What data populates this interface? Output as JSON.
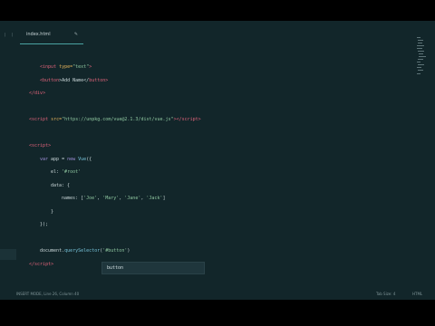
{
  "tab": {
    "filename": "index.html",
    "close_glyph": "✎"
  },
  "sidebar": {
    "toggle_glyph": "⟨ ⟩"
  },
  "code_lines": {
    "l1": {
      "open": "<",
      "tag": "input",
      "attr": " type=",
      "str": "\"text\"",
      "close": ">"
    },
    "l2": {
      "open": "<",
      "tag": "button",
      "mid": ">Add Name</",
      "tag2": "button",
      "close": ">"
    },
    "l3": {
      "open": "</",
      "tag": "div",
      "close": ">"
    },
    "l4": {
      "open": "<",
      "tag": "script",
      "attr": " src=",
      "str": "\"https://unpkg.com/vue@2.1.3/dist/vue.js\"",
      "close": "></",
      "tag2": "script",
      "close2": ">"
    },
    "l5": {
      "open": "<",
      "tag": "script",
      "close": ">"
    },
    "l6": {
      "kw": "var",
      "txt": " app = ",
      "kw2": "new",
      "fn": " Vue",
      "rest": "({"
    },
    "l7": {
      "txt": "el: ",
      "str": "'#root'"
    },
    "l8": {
      "txt": "data: {"
    },
    "l9": {
      "txt": "names: [",
      "s1": "'Joe'",
      "c1": ", ",
      "s2": "'Mary'",
      "c2": ", ",
      "s3": "'Jane'",
      "c3": ", ",
      "s4": "'Jack'",
      "end": "]"
    },
    "l10": {
      "txt": "}"
    },
    "l11": {
      "txt": "});"
    },
    "l12": {
      "txt": "document.",
      "fn": "querySelector",
      "p": "(",
      "str": "'#button'",
      "p2": ")"
    },
    "l13": {
      "open": "</",
      "tag": "script",
      "close": ">"
    }
  },
  "autocomplete": {
    "item": "button"
  },
  "status": {
    "left": "INSERT MODE, Line 26, Column 40",
    "tab_size": "Tab Size: 4",
    "syntax": "HTML"
  },
  "colors": {
    "background": "#12262a",
    "tag": "#e0637a",
    "string": "#8fc7a0",
    "attribute": "#e6b35a"
  }
}
